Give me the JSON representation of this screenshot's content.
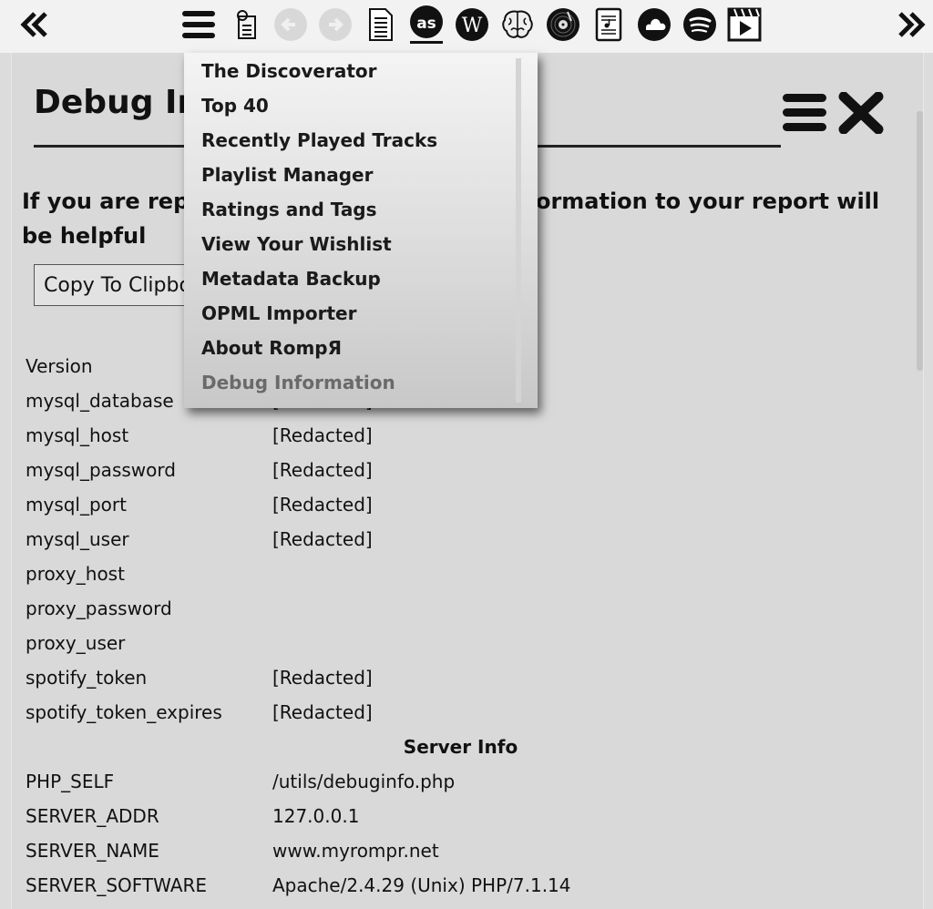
{
  "toolbar": {
    "icons": [
      {
        "name": "rewind-icon"
      },
      {
        "name": "hamburger-menu-icon"
      },
      {
        "name": "lyrics-icon"
      },
      {
        "name": "back-icon"
      },
      {
        "name": "forward-icon"
      },
      {
        "name": "document-icon"
      },
      {
        "name": "lastfm-icon"
      },
      {
        "name": "wikipedia-icon"
      },
      {
        "name": "brain-icon"
      },
      {
        "name": "vinyl-icon"
      },
      {
        "name": "sheet-music-icon"
      },
      {
        "name": "soundcloud-icon"
      },
      {
        "name": "spotify-icon"
      },
      {
        "name": "video-icon"
      },
      {
        "name": "fast-forward-icon"
      }
    ]
  },
  "panel": {
    "title": "Debug Information",
    "intro": "If you are reporting a bug, adding this information to your report will be helpful",
    "copy_button": "Copy To Clipboard"
  },
  "dropdown": {
    "items": [
      {
        "label": "The Discoverator",
        "enabled": true
      },
      {
        "label": "Top 40",
        "enabled": true
      },
      {
        "label": "Recently Played Tracks",
        "enabled": true
      },
      {
        "label": "Playlist Manager",
        "enabled": true
      },
      {
        "label": "Ratings and Tags",
        "enabled": true
      },
      {
        "label": "View Your Wishlist",
        "enabled": true
      },
      {
        "label": "Metadata Backup",
        "enabled": true
      },
      {
        "label": "OPML Importer",
        "enabled": true
      },
      {
        "label": "About RompЯ",
        "enabled": true
      },
      {
        "label": "Debug Information",
        "enabled": false
      }
    ]
  },
  "prefs": [
    {
      "key": "Version",
      "value": ""
    },
    {
      "key": "mysql_database",
      "value": "[Redacted]"
    },
    {
      "key": "mysql_host",
      "value": "[Redacted]"
    },
    {
      "key": "mysql_password",
      "value": "[Redacted]"
    },
    {
      "key": "mysql_port",
      "value": "[Redacted]"
    },
    {
      "key": "mysql_user",
      "value": "[Redacted]"
    },
    {
      "key": "proxy_host",
      "value": ""
    },
    {
      "key": "proxy_password",
      "value": ""
    },
    {
      "key": "proxy_user",
      "value": ""
    },
    {
      "key": "spotify_token",
      "value": "[Redacted]"
    },
    {
      "key": "spotify_token_expires",
      "value": "[Redacted]"
    }
  ],
  "server_info": {
    "title": "Server Info",
    "rows": [
      {
        "key": "PHP_SELF",
        "value": "/utils/debuginfo.php"
      },
      {
        "key": "SERVER_ADDR",
        "value": "127.0.0.1"
      },
      {
        "key": "SERVER_NAME",
        "value": "www.myrompr.net"
      },
      {
        "key": "SERVER_SOFTWARE",
        "value": "Apache/2.4.29 (Unix) PHP/7.1.14"
      }
    ]
  }
}
